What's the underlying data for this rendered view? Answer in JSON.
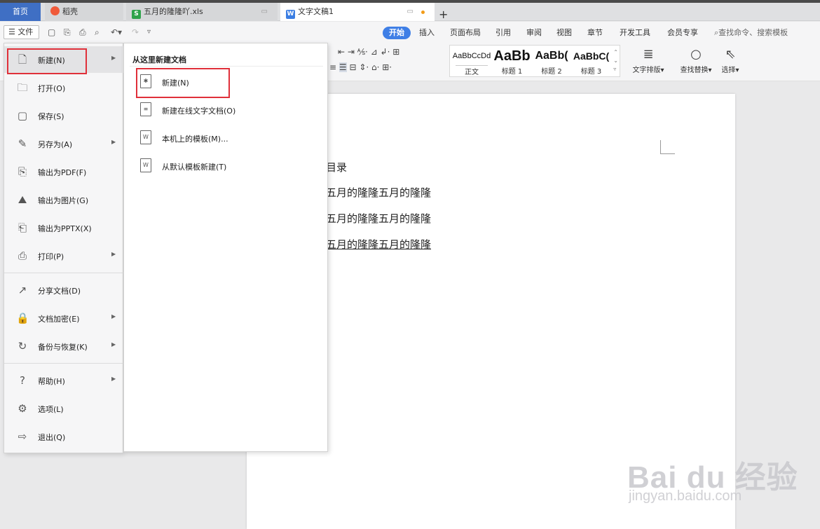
{
  "tabs": {
    "home": "首页",
    "daoke": "稻壳",
    "xls": "五月的隆隆吖.xls",
    "doc": "文字文稿1",
    "xls_icon": "S",
    "doc_icon": "W"
  },
  "toolbar": {
    "file_label": "文件",
    "ribbon_tabs": [
      "开始",
      "插入",
      "页面布局",
      "引用",
      "审阅",
      "视图",
      "章节",
      "开发工具",
      "会员专享"
    ],
    "search_cmd": "查找命令、搜索模板"
  },
  "ribbon": {
    "styles": [
      {
        "preview": "AaBbCcDd",
        "caption": "正文"
      },
      {
        "preview": "AaBb",
        "caption": "标题 1"
      },
      {
        "preview": "AaBb(",
        "caption": "标题 2"
      },
      {
        "preview": "AaBbC(",
        "caption": "标题 3"
      }
    ],
    "text_layout": "文字排版",
    "find_replace": "查找替换",
    "select": "选择"
  },
  "document": {
    "lines": [
      "目录",
      "五月的隆隆五月的隆隆",
      "五月的隆隆五月的隆隆",
      "五月的隆隆五月的隆隆"
    ]
  },
  "file_menu": {
    "items": [
      {
        "label": "新建(N)",
        "icon": "new-doc-icon",
        "arrow": true
      },
      {
        "label": "打开(O)",
        "icon": "folder-icon",
        "arrow": false
      },
      {
        "label": "保存(S)",
        "icon": "save-icon",
        "arrow": false
      },
      {
        "label": "另存为(A)",
        "icon": "save-as-icon",
        "arrow": true
      },
      {
        "label": "输出为PDF(F)",
        "icon": "pdf-export-icon",
        "arrow": false
      },
      {
        "label": "输出为图片(G)",
        "icon": "image-export-icon",
        "arrow": false
      },
      {
        "label": "输出为PPTX(X)",
        "icon": "pptx-export-icon",
        "arrow": false
      },
      {
        "label": "打印(P)",
        "icon": "print-icon",
        "arrow": true
      },
      {
        "label": "分享文档(D)",
        "icon": "share-icon",
        "arrow": false
      },
      {
        "label": "文档加密(E)",
        "icon": "encrypt-icon",
        "arrow": true
      },
      {
        "label": "备份与恢复(K)",
        "icon": "backup-icon",
        "arrow": true
      },
      {
        "label": "帮助(H)",
        "icon": "help-icon",
        "arrow": true
      },
      {
        "label": "选项(L)",
        "icon": "gear-icon",
        "arrow": false
      },
      {
        "label": "退出(Q)",
        "icon": "exit-icon",
        "arrow": false
      }
    ]
  },
  "new_submenu": {
    "title": "从这里新建文档",
    "items": [
      {
        "label": "新建(N)",
        "icon": "new-doc-icon"
      },
      {
        "label": "新建在线文字文档(O)",
        "icon": "online-doc-icon"
      },
      {
        "label": "本机上的模板(M)...",
        "icon": "template-icon"
      },
      {
        "label": "从默认模板新建(T)",
        "icon": "default-template-icon"
      }
    ]
  },
  "watermark": {
    "main": "Bai du 经验",
    "url": "jingyan.baidu.com"
  },
  "colors": {
    "accent": "#3f6fc4",
    "highlight_box": "#e0303a",
    "active_tab": "#3f7fe6"
  }
}
